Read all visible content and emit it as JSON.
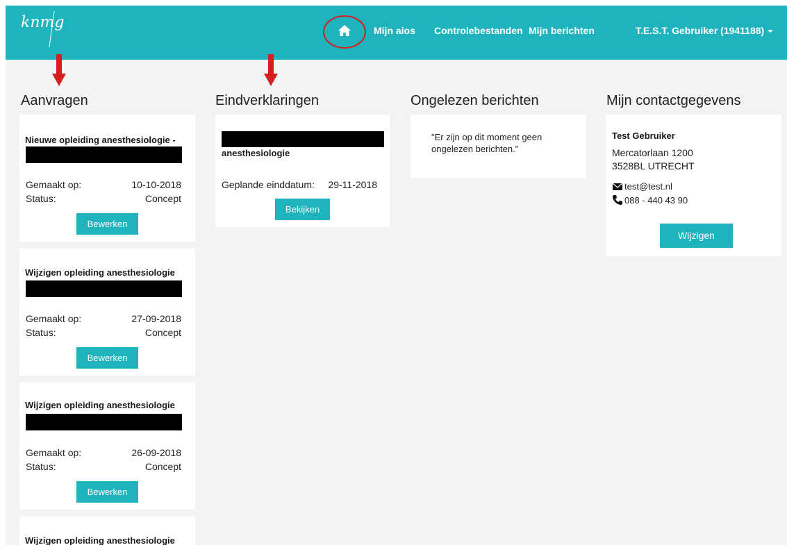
{
  "nav": {
    "logo": "knmg",
    "home_icon": "home-icon",
    "links": [
      "Mijn aios",
      "Controlebestanden",
      "Mijn berichten"
    ],
    "user": "T.E.S.T. Gebruiker (1941188)"
  },
  "colors": {
    "brand": "#1fb3bd",
    "annotation_red": "#d61e1e",
    "background": "#f3f3f3"
  },
  "aanvragen": {
    "title": "Aanvragen",
    "cards": [
      {
        "title": "Nieuwe opleiding anesthesiologie -",
        "created_label": "Gemaakt op:",
        "created": "10-10-2018",
        "status_label": "Status:",
        "status": "Concept",
        "button": "Bewerken"
      },
      {
        "title": "Wijzigen opleiding anesthesiologie",
        "created_label": "Gemaakt op:",
        "created": "27-09-2018",
        "status_label": "Status:",
        "status": "Concept",
        "button": "Bewerken"
      },
      {
        "title": "Wijzigen opleiding anesthesiologie",
        "created_label": "Gemaakt op:",
        "created": "26-09-2018",
        "status_label": "Status:",
        "status": "Concept",
        "button": "Bewerken"
      },
      {
        "title": "Wijzigen opleiding anesthesiologie"
      }
    ]
  },
  "eindverklaringen": {
    "title": "Eindverklaringen",
    "card": {
      "subtitle": "anesthesiologie",
      "date_label": "Geplande einddatum:",
      "date": "29-11-2018",
      "button": "Bekijken"
    }
  },
  "berichten": {
    "title": "Ongelezen berichten",
    "empty_text": "\"Er zijn op dit moment geen ongelezen berichten.\""
  },
  "contact": {
    "title": "Mijn contactgegevens",
    "name": "Test Gebruiker",
    "street": "Mercatorlaan 1200",
    "city": "3528BL UTRECHT",
    "email": "test@test.nl",
    "phone": "088 - 440 43 90",
    "button": "Wijzigen"
  }
}
